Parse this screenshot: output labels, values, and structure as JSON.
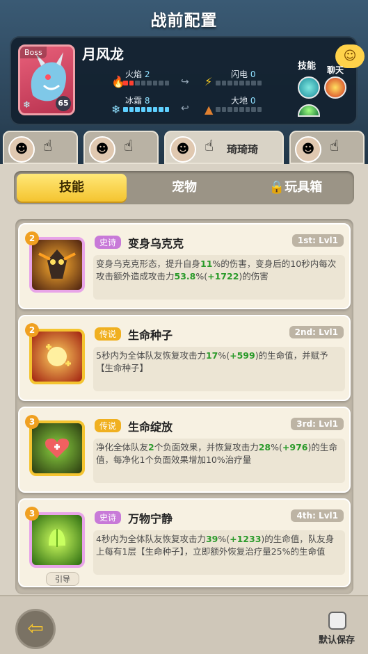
{
  "title": "战前配置",
  "hero": {
    "badge": "Boss",
    "name": "月风龙",
    "level": "65",
    "stats": [
      {
        "label": "火焰",
        "value": "2",
        "type": "fire",
        "level": 2
      },
      {
        "label": "闪电",
        "value": "0",
        "type": "thunder",
        "level": 0
      },
      {
        "label": "冰霜",
        "value": "8",
        "type": "ice",
        "level": 8
      },
      {
        "label": "大地",
        "value": "0",
        "type": "earth",
        "level": 0
      }
    ],
    "skills_label": "技能",
    "chat_label": "聊天"
  },
  "hero_tabs": [
    {
      "name": "",
      "icon": "hero-avatar-1"
    },
    {
      "name": "",
      "icon": "hero-avatar-2"
    },
    {
      "name": "琦琦琦",
      "icon": "hero-avatar-3",
      "active": true
    },
    {
      "name": "",
      "icon": "hero-avatar-4"
    }
  ],
  "segments": {
    "skills": "技能",
    "pets": "宠物",
    "toybox": "玩具箱"
  },
  "skills": [
    {
      "num": "2",
      "rarity": "史诗",
      "rarity_type": "epic",
      "name": "变身乌克克",
      "slot": "1st: Lvl1",
      "desc_parts": [
        "变身乌克克形态，提升自身",
        "11",
        "%的伤害，变身后的10秒内每次攻击额外造成攻击力",
        "53.8",
        "%(",
        "+1722",
        ")的伤害"
      ]
    },
    {
      "num": "2",
      "rarity": "传说",
      "rarity_type": "legend",
      "name": "生命种子",
      "slot": "2nd: Lvl1",
      "desc_parts": [
        "5秒内为全体队友恢复攻击力",
        "17",
        "%(",
        "+599",
        ")的生命值，并赋予【生命种子】"
      ]
    },
    {
      "num": "3",
      "rarity": "传说",
      "rarity_type": "legend",
      "name": "生命绽放",
      "slot": "3rd: Lvl1",
      "desc_parts": [
        "净化全体队友",
        "2",
        "个负面效果，并恢复攻击力",
        "28",
        "%(",
        "+976",
        ")的生命值，每净化1个负面效果增加10%治疗量"
      ]
    },
    {
      "num": "3",
      "rarity": "史诗",
      "rarity_type": "epic",
      "name": "万物宁静",
      "slot": "4th: Lvl1",
      "tag": "引导",
      "desc_parts": [
        "4秒内为全体队友恢复攻击力",
        "39",
        "%(",
        "+1233",
        ")的生命值，队友身上每有1层【生命种子】，立即额外恢复治疗量25%的生命值"
      ]
    }
  ],
  "bottom": {
    "default_save": "默认保存"
  }
}
